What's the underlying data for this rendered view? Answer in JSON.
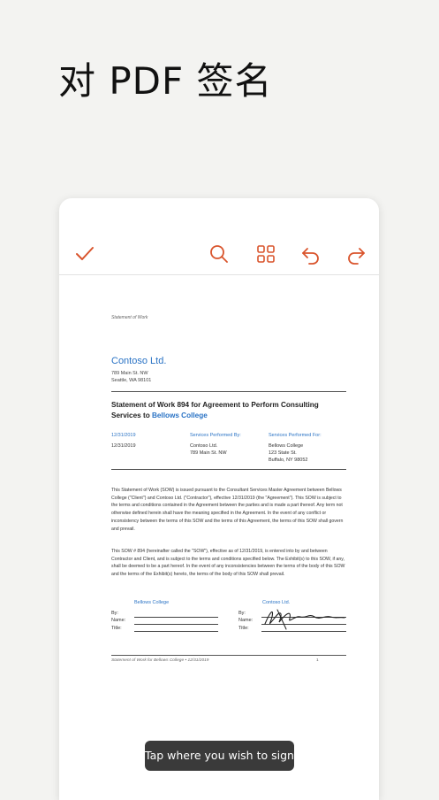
{
  "headline": "对 PDF 签名",
  "toolbar": {
    "done": "checkmark-icon",
    "search": "search-icon",
    "grid": "grid-icon",
    "undo": "undo-icon",
    "redo": "redo-icon",
    "accent": "#d9542c"
  },
  "document": {
    "header_note": "Statement of Work",
    "company": "Contoso Ltd.",
    "address_line1": "789 Main St. NW",
    "address_line2": "Seattle, WA 98101",
    "title_prefix": "Statement of Work 894 for Agreement to Perform Consulting Services to ",
    "title_highlight": "Bellows College",
    "columns": {
      "date_label": "12/31/2019",
      "date_value": "12/31/2019",
      "performed_by_label": "Services Performed By:",
      "performed_by_line1": "Contoso Ltd.",
      "performed_by_line2": "789 Main St. NW",
      "performed_for_label": "Services Performed For:",
      "performed_for_line1": "Bellows College",
      "performed_for_line2": "123 State St.",
      "performed_for_line3": "Buffalo, NY 98052"
    },
    "paragraph1": "This Statement of Work (SOW) is issued pursuant to the Consultant Services Master Agreement between Bellows College (\"Client\") and Contoso Ltd. (\"Contractor\"), effective 12/31/2019 (the \"Agreement\"). This SOW is subject to the terms and conditions contained in the Agreement between the parties and is made a part thereof. Any term not otherwise defined herein shall have the meaning specified in the Agreement. In the event of any conflict or inconsistency between the terms of this SOW and the terms of this Agreement, the terms of this SOW shall govern and prevail.",
    "paragraph2": "This SOW # 894 (hereinafter called the \"SOW\"), effective as of 12/31/2019, is entered into by and between Contractor and Client, and is subject to the terms and conditions specified below. The Exhibit(s) to this SOW, if any, shall be deemed to be a part hereof. In the event of any inconsistencies between the terms of the body of this SOW and the terms of the Exhibit(s) hereto, the terms of the body of this SOW shall prevail.",
    "sig_left_name": "Bellows College",
    "sig_right_name": "Contoso Ltd.",
    "sig_by": "By:",
    "sig_name": "Name:",
    "sig_title": "Title:",
    "footer_left": "Statement of Work for Bellows College • 12/31/2019",
    "footer_page": "1"
  },
  "toast": "Tap where you wish to sign"
}
